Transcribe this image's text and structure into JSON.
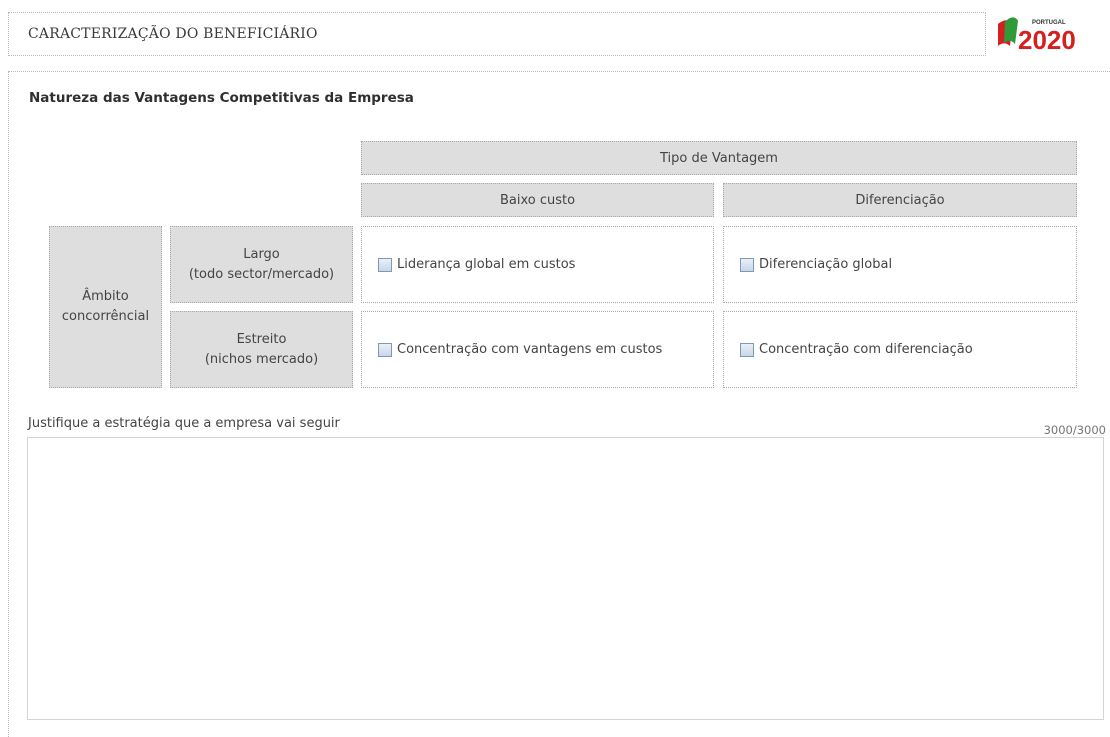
{
  "header": {
    "title": "CARACTERIZAÇÃO DO BENEFICIÁRIO"
  },
  "logo": {
    "small_text": "PORTUGAL",
    "big_text": "2020",
    "flag_colors": [
      "#d4211f",
      "#2f9a3a"
    ]
  },
  "section": {
    "title": "Natureza das Vantagens Competitivas da Empresa"
  },
  "matrix": {
    "column_group_header": "Tipo de Vantagem",
    "columns": [
      "Baixo custo",
      "Diferenciação"
    ],
    "row_group_label": [
      "Âmbito",
      "concorrêncial"
    ],
    "rows": [
      {
        "label": [
          "Largo",
          "(todo sector/mercado)"
        ],
        "options": [
          {
            "label": "Liderança global em custos",
            "checked": false
          },
          {
            "label": "Diferenciação global",
            "checked": false
          }
        ]
      },
      {
        "label": [
          "Estreito",
          "(nichos mercado)"
        ],
        "options": [
          {
            "label": "Concentração com vantagens em custos",
            "checked": false
          },
          {
            "label": "Concentração com diferenciação",
            "checked": false
          }
        ]
      }
    ]
  },
  "justification": {
    "label": "Justifique a estratégia que a empresa vai seguir",
    "counter": "3000/3000",
    "value": ""
  }
}
